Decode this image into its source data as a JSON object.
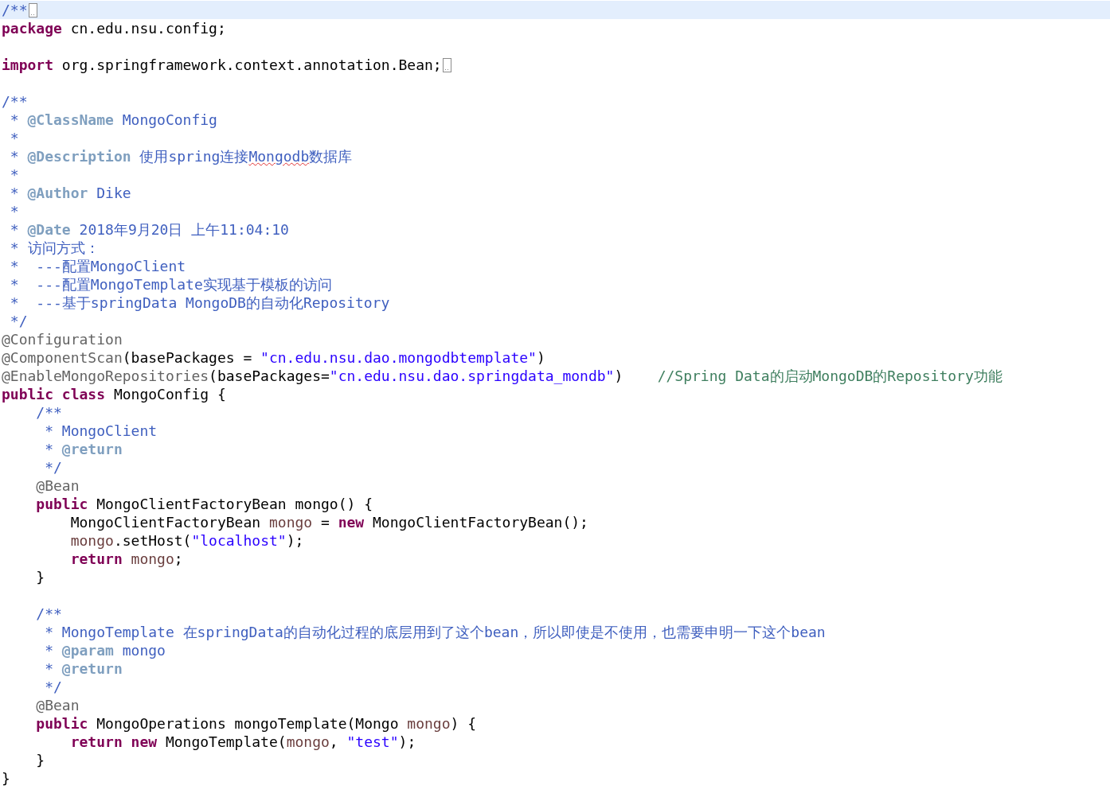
{
  "editor": {
    "lines": [
      {
        "current": true,
        "folded": true,
        "tokens": [
          {
            "kind": "jdoc",
            "text": "/**"
          }
        ]
      },
      {
        "current": false,
        "folded": false,
        "tokens": [
          {
            "kind": "kw",
            "text": "package"
          },
          {
            "kind": "plain",
            "text": " cn.edu.nsu.config;"
          }
        ]
      },
      {
        "current": false,
        "folded": false
      },
      {
        "current": false,
        "folded": true,
        "tokens": [
          {
            "kind": "kw",
            "text": "import"
          },
          {
            "kind": "plain",
            "text": " org.springframework.context.annotation.Bean;"
          }
        ]
      },
      {
        "current": false,
        "folded": false
      },
      {
        "current": false,
        "folded": false,
        "tokens": [
          {
            "kind": "jdoc",
            "text": "/**"
          }
        ]
      },
      {
        "current": false,
        "folded": false,
        "tokens": [
          {
            "kind": "jdoc",
            "text": " * "
          },
          {
            "kind": "jtag",
            "text": "@ClassName"
          },
          {
            "kind": "jdoc",
            "text": " MongoConfig"
          }
        ]
      },
      {
        "current": false,
        "folded": false,
        "tokens": [
          {
            "kind": "jdoc",
            "text": " *"
          }
        ]
      },
      {
        "current": false,
        "folded": false,
        "tokens": [
          {
            "kind": "jdoc",
            "text": " * "
          },
          {
            "kind": "jtag",
            "text": "@Description"
          },
          {
            "kind": "jdoc",
            "text": " 使用spring连接"
          },
          {
            "kind": "spell",
            "text": "Mongodb"
          },
          {
            "kind": "jdoc",
            "text": "数据库"
          }
        ]
      },
      {
        "current": false,
        "folded": false,
        "tokens": [
          {
            "kind": "jdoc",
            "text": " *"
          }
        ]
      },
      {
        "current": false,
        "folded": false,
        "tokens": [
          {
            "kind": "jdoc",
            "text": " * "
          },
          {
            "kind": "jtag",
            "text": "@Author"
          },
          {
            "kind": "jdoc",
            "text": " Dike"
          }
        ]
      },
      {
        "current": false,
        "folded": false,
        "tokens": [
          {
            "kind": "jdoc",
            "text": " *"
          }
        ]
      },
      {
        "current": false,
        "folded": false,
        "tokens": [
          {
            "kind": "jdoc",
            "text": " * "
          },
          {
            "kind": "jtag",
            "text": "@Date"
          },
          {
            "kind": "jdoc",
            "text": " 2018年9月20日 上午11:04:10"
          }
        ]
      },
      {
        "current": false,
        "folded": false,
        "tokens": [
          {
            "kind": "jdoc",
            "text": " * 访问方式："
          }
        ]
      },
      {
        "current": false,
        "folded": false,
        "tokens": [
          {
            "kind": "jdoc",
            "text": " *  ---配置MongoClient"
          }
        ]
      },
      {
        "current": false,
        "folded": false,
        "tokens": [
          {
            "kind": "jdoc",
            "text": " *  ---配置MongoTemplate实现基于模板的访问"
          }
        ]
      },
      {
        "current": false,
        "folded": false,
        "tokens": [
          {
            "kind": "jdoc",
            "text": " *  ---基于springData MongoDB的自动化Repository"
          }
        ]
      },
      {
        "current": false,
        "folded": false,
        "tokens": [
          {
            "kind": "jdoc",
            "text": " */"
          }
        ]
      },
      {
        "current": false,
        "folded": false,
        "tokens": [
          {
            "kind": "ann",
            "text": "@Configuration"
          }
        ]
      },
      {
        "current": false,
        "folded": false,
        "tokens": [
          {
            "kind": "ann",
            "text": "@ComponentScan"
          },
          {
            "kind": "plain",
            "text": "(basePackages = "
          },
          {
            "kind": "str",
            "text": "\"cn.edu.nsu.dao.mongodbtemplate\""
          },
          {
            "kind": "plain",
            "text": ")"
          }
        ]
      },
      {
        "current": false,
        "folded": false,
        "tokens": [
          {
            "kind": "ann",
            "text": "@EnableMongoRepositories"
          },
          {
            "kind": "plain",
            "text": "(basePackages="
          },
          {
            "kind": "str",
            "text": "\"cn.edu.nsu.dao.springdata_mondb\""
          },
          {
            "kind": "plain",
            "text": ")    "
          },
          {
            "kind": "comment",
            "text": "//Spring Data的启动MongoDB的Repository功能"
          }
        ]
      },
      {
        "current": false,
        "folded": false,
        "tokens": [
          {
            "kind": "kw",
            "text": "public class"
          },
          {
            "kind": "plain",
            "text": " MongoConfig {"
          }
        ]
      },
      {
        "current": false,
        "folded": false,
        "tokens": [
          {
            "kind": "jdoc",
            "text": "    /**"
          }
        ]
      },
      {
        "current": false,
        "folded": false,
        "tokens": [
          {
            "kind": "jdoc",
            "text": "     * MongoClient"
          }
        ]
      },
      {
        "current": false,
        "folded": false,
        "tokens": [
          {
            "kind": "jdoc",
            "text": "     * "
          },
          {
            "kind": "jtag",
            "text": "@return"
          }
        ]
      },
      {
        "current": false,
        "folded": false,
        "tokens": [
          {
            "kind": "jdoc",
            "text": "     */"
          }
        ]
      },
      {
        "current": false,
        "folded": false,
        "tokens": [
          {
            "kind": "ann",
            "text": "    @Bean"
          }
        ]
      },
      {
        "current": false,
        "folded": false,
        "tokens": [
          {
            "kind": "kw",
            "text": "    public"
          },
          {
            "kind": "plain",
            "text": " MongoClientFactoryBean mongo() {"
          }
        ]
      },
      {
        "current": false,
        "folded": false,
        "tokens": [
          {
            "kind": "plain",
            "text": "        MongoClientFactoryBean "
          },
          {
            "kind": "local",
            "text": "mongo"
          },
          {
            "kind": "plain",
            "text": " = "
          },
          {
            "kind": "kw",
            "text": "new"
          },
          {
            "kind": "plain",
            "text": " MongoClientFactoryBean();"
          }
        ]
      },
      {
        "current": false,
        "folded": false,
        "tokens": [
          {
            "kind": "local",
            "text": "        mongo"
          },
          {
            "kind": "plain",
            "text": ".setHost("
          },
          {
            "kind": "str",
            "text": "\"localhost\""
          },
          {
            "kind": "plain",
            "text": ");"
          }
        ]
      },
      {
        "current": false,
        "folded": false,
        "tokens": [
          {
            "kind": "kw",
            "text": "        return"
          },
          {
            "kind": "local",
            "text": " mongo"
          },
          {
            "kind": "plain",
            "text": ";"
          }
        ]
      },
      {
        "current": false,
        "folded": false,
        "tokens": [
          {
            "kind": "plain",
            "text": "    }"
          }
        ]
      },
      {
        "current": false,
        "folded": false
      },
      {
        "current": false,
        "folded": false,
        "tokens": [
          {
            "kind": "jdoc",
            "text": "    /**"
          }
        ]
      },
      {
        "current": false,
        "folded": false,
        "tokens": [
          {
            "kind": "jdoc",
            "text": "     * MongoTemplate 在springData的自动化过程的底层用到了这个bean，所以即使是不使用，也需要申明一下这个bean"
          }
        ]
      },
      {
        "current": false,
        "folded": false,
        "tokens": [
          {
            "kind": "jdoc",
            "text": "     * "
          },
          {
            "kind": "jtag",
            "text": "@param"
          },
          {
            "kind": "jdoc",
            "text": " mongo"
          }
        ]
      },
      {
        "current": false,
        "folded": false,
        "tokens": [
          {
            "kind": "jdoc",
            "text": "     * "
          },
          {
            "kind": "jtag",
            "text": "@return"
          }
        ]
      },
      {
        "current": false,
        "folded": false,
        "tokens": [
          {
            "kind": "jdoc",
            "text": "     */"
          }
        ]
      },
      {
        "current": false,
        "folded": false,
        "tokens": [
          {
            "kind": "ann",
            "text": "    @Bean"
          }
        ]
      },
      {
        "current": false,
        "folded": false,
        "tokens": [
          {
            "kind": "kw",
            "text": "    public"
          },
          {
            "kind": "plain",
            "text": " MongoOperations mongoTemplate(Mongo "
          },
          {
            "kind": "local",
            "text": "mongo"
          },
          {
            "kind": "plain",
            "text": ") {"
          }
        ]
      },
      {
        "current": false,
        "folded": false,
        "tokens": [
          {
            "kind": "kw",
            "text": "        return new"
          },
          {
            "kind": "plain",
            "text": " MongoTemplate("
          },
          {
            "kind": "local",
            "text": "mongo"
          },
          {
            "kind": "plain",
            "text": ", "
          },
          {
            "kind": "str",
            "text": "\"test\""
          },
          {
            "kind": "plain",
            "text": ");"
          }
        ]
      },
      {
        "current": false,
        "folded": false,
        "tokens": [
          {
            "kind": "plain",
            "text": "    }"
          }
        ]
      },
      {
        "current": false,
        "folded": false,
        "tokens": [
          {
            "kind": "plain",
            "text": "}"
          }
        ]
      }
    ]
  }
}
